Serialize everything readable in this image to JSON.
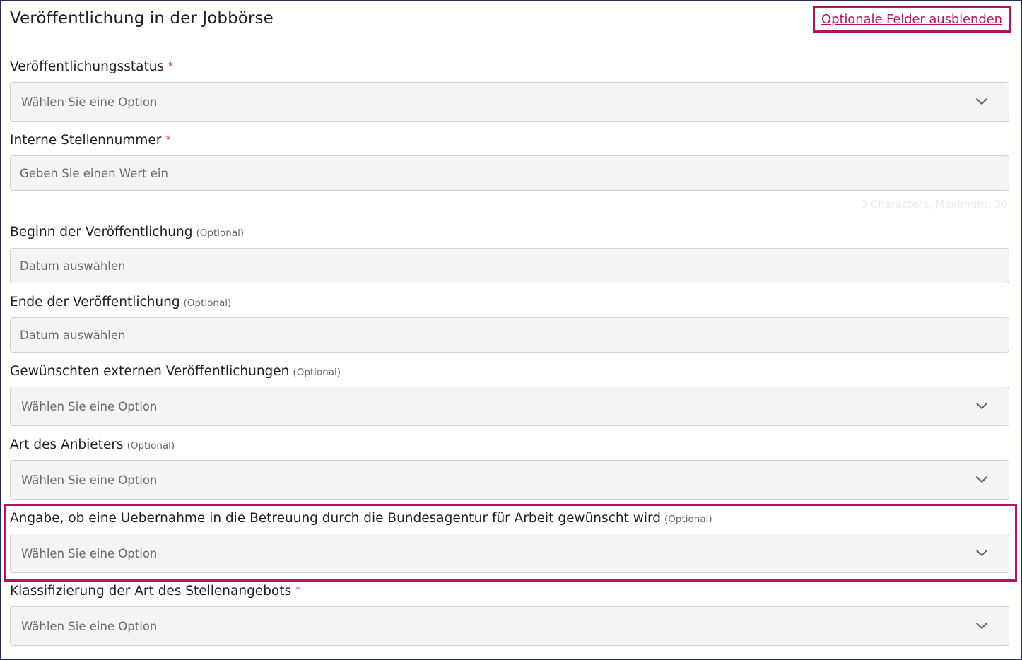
{
  "section": {
    "title": "Veröffentlichung in der Jobbörse",
    "toggle_optional_label": "Optionale Felder ausblenden"
  },
  "markers": {
    "required": "*",
    "optional": "(Optional)"
  },
  "fields": {
    "publication_status": {
      "label": "Veröffentlichungsstatus",
      "placeholder": "Wählen Sie eine Option"
    },
    "internal_job_number": {
      "label": "Interne Stellennummer",
      "placeholder": "Geben Sie einen Wert ein",
      "counter": "0 Characters, Maximum: 30"
    },
    "publication_start": {
      "label": "Beginn der Veröffentlichung",
      "placeholder": "Datum auswählen"
    },
    "publication_end": {
      "label": "Ende der Veröffentlichung",
      "placeholder": "Datum auswählen"
    },
    "external_publications": {
      "label": "Gewünschten externen Veröffentlichungen",
      "placeholder": "Wählen Sie eine Option"
    },
    "provider_type": {
      "label": "Art des Anbieters",
      "placeholder": "Wählen Sie eine Option"
    },
    "ba_takeover": {
      "label": "Angabe, ob eine Uebernahme in die Betreuung durch die Bundesagentur für Arbeit gewünscht wird",
      "placeholder": "Wählen Sie eine Option"
    },
    "offer_classification": {
      "label": "Klassifizierung der Art des Stellenangebots",
      "placeholder": "Wählen Sie eine Option"
    }
  },
  "colors": {
    "accent": "#b5135f",
    "required": "#d23b3b",
    "control_bg": "#f4f4f4"
  }
}
